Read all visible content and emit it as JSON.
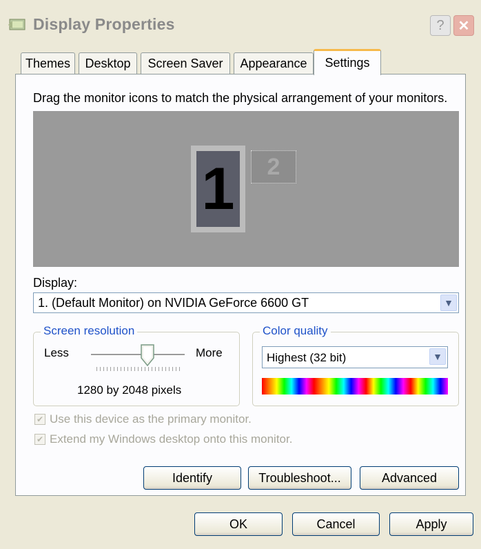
{
  "window": {
    "title": "Display Properties",
    "help_label": "?",
    "close_label": "✕"
  },
  "tabs": [
    {
      "label": "Themes",
      "active": false
    },
    {
      "label": "Desktop",
      "active": false
    },
    {
      "label": "Screen Saver",
      "active": false
    },
    {
      "label": "Appearance",
      "active": false
    },
    {
      "label": "Settings",
      "active": true
    }
  ],
  "settings": {
    "instruction": "Drag the monitor icons to match the physical arrangement of your monitors.",
    "monitors": [
      {
        "label": "1",
        "active": true
      },
      {
        "label": "2",
        "active": false
      }
    ],
    "display_label": "Display:",
    "display_value": "1. (Default Monitor) on NVIDIA GeForce 6600 GT",
    "resolution": {
      "group_title": "Screen resolution",
      "less_label": "Less",
      "more_label": "More",
      "value_text": "1280 by 2048 pixels",
      "slider_level": 0.6
    },
    "color_quality": {
      "group_title": "Color quality",
      "selected": "Highest (32 bit)"
    },
    "checkboxes": [
      {
        "label": "Use this device as the primary monitor.",
        "checked": true,
        "enabled": false
      },
      {
        "label": "Extend my Windows desktop onto this monitor.",
        "checked": true,
        "enabled": false
      }
    ],
    "buttons": {
      "identify": "Identify",
      "troubleshoot": "Troubleshoot...",
      "advanced": "Advanced"
    }
  },
  "footer": {
    "ok": "OK",
    "cancel": "Cancel",
    "apply": "Apply"
  },
  "colors": {
    "tab_accent": "#f6b94b",
    "group_title": "#1f52c9",
    "preview_bg": "#9a9a9a",
    "disabled_text": "#a8a79b"
  }
}
